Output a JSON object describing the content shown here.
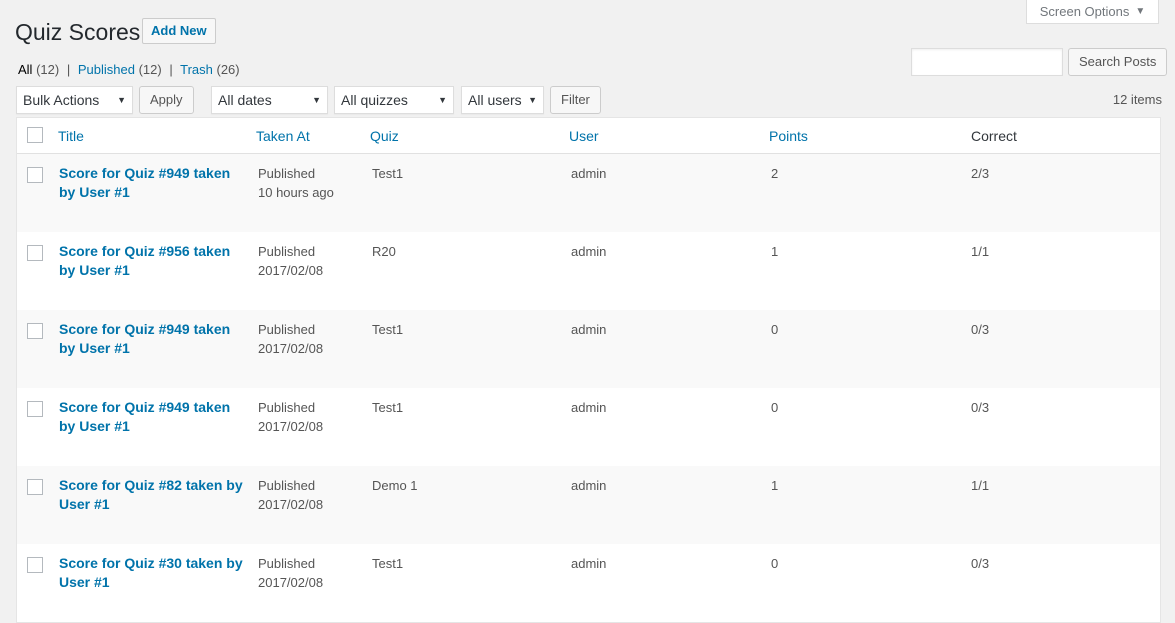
{
  "screen_options": {
    "label": "Screen Options",
    "arrow": "▼"
  },
  "page": {
    "title": "Quiz Scores",
    "add_new_label": "Add New"
  },
  "views": {
    "all_label": "All",
    "all_count": "(12)",
    "published_label": "Published",
    "published_count": "(12)",
    "trash_label": "Trash",
    "trash_count": "(26)",
    "separator": "|"
  },
  "search": {
    "button_label": "Search Posts",
    "value": ""
  },
  "filters": {
    "bulk_actions": "Bulk Actions",
    "apply_label": "Apply",
    "dates": "All dates",
    "quizzes": "All quizzes",
    "users": "All users",
    "filter_label": "Filter",
    "caret": "▼"
  },
  "items_count": "12 items",
  "table": {
    "columns": {
      "title": "Title",
      "taken_at": "Taken At",
      "quiz": "Quiz",
      "user": "User",
      "points": "Points",
      "correct": "Correct"
    },
    "rows": [
      {
        "title": "Score for Quiz #949 taken by User #1",
        "status": "Published",
        "date": "10 hours ago",
        "quiz": "Test1",
        "user": "admin",
        "points": "2",
        "correct": "2/3"
      },
      {
        "title": "Score for Quiz #956 taken by User #1",
        "status": "Published",
        "date": "2017/02/08",
        "quiz": "R20",
        "user": "admin",
        "points": "1",
        "correct": "1/1"
      },
      {
        "title": "Score for Quiz #949 taken by User #1",
        "status": "Published",
        "date": "2017/02/08",
        "quiz": "Test1",
        "user": "admin",
        "points": "0",
        "correct": "0/3"
      },
      {
        "title": "Score for Quiz #949 taken by User #1",
        "status": "Published",
        "date": "2017/02/08",
        "quiz": "Test1",
        "user": "admin",
        "points": "0",
        "correct": "0/3"
      },
      {
        "title": "Score for Quiz #82 taken by User #1",
        "status": "Published",
        "date": "2017/02/08",
        "quiz": "Demo 1",
        "user": "admin",
        "points": "1",
        "correct": "1/1"
      },
      {
        "title": "Score for Quiz #30 taken by User #1",
        "status": "Published",
        "date": "2017/02/08",
        "quiz": "Test1",
        "user": "admin",
        "points": "0",
        "correct": "0/3"
      }
    ]
  },
  "colors": {
    "link": "#0073aa",
    "background": "#f1f1f1"
  }
}
